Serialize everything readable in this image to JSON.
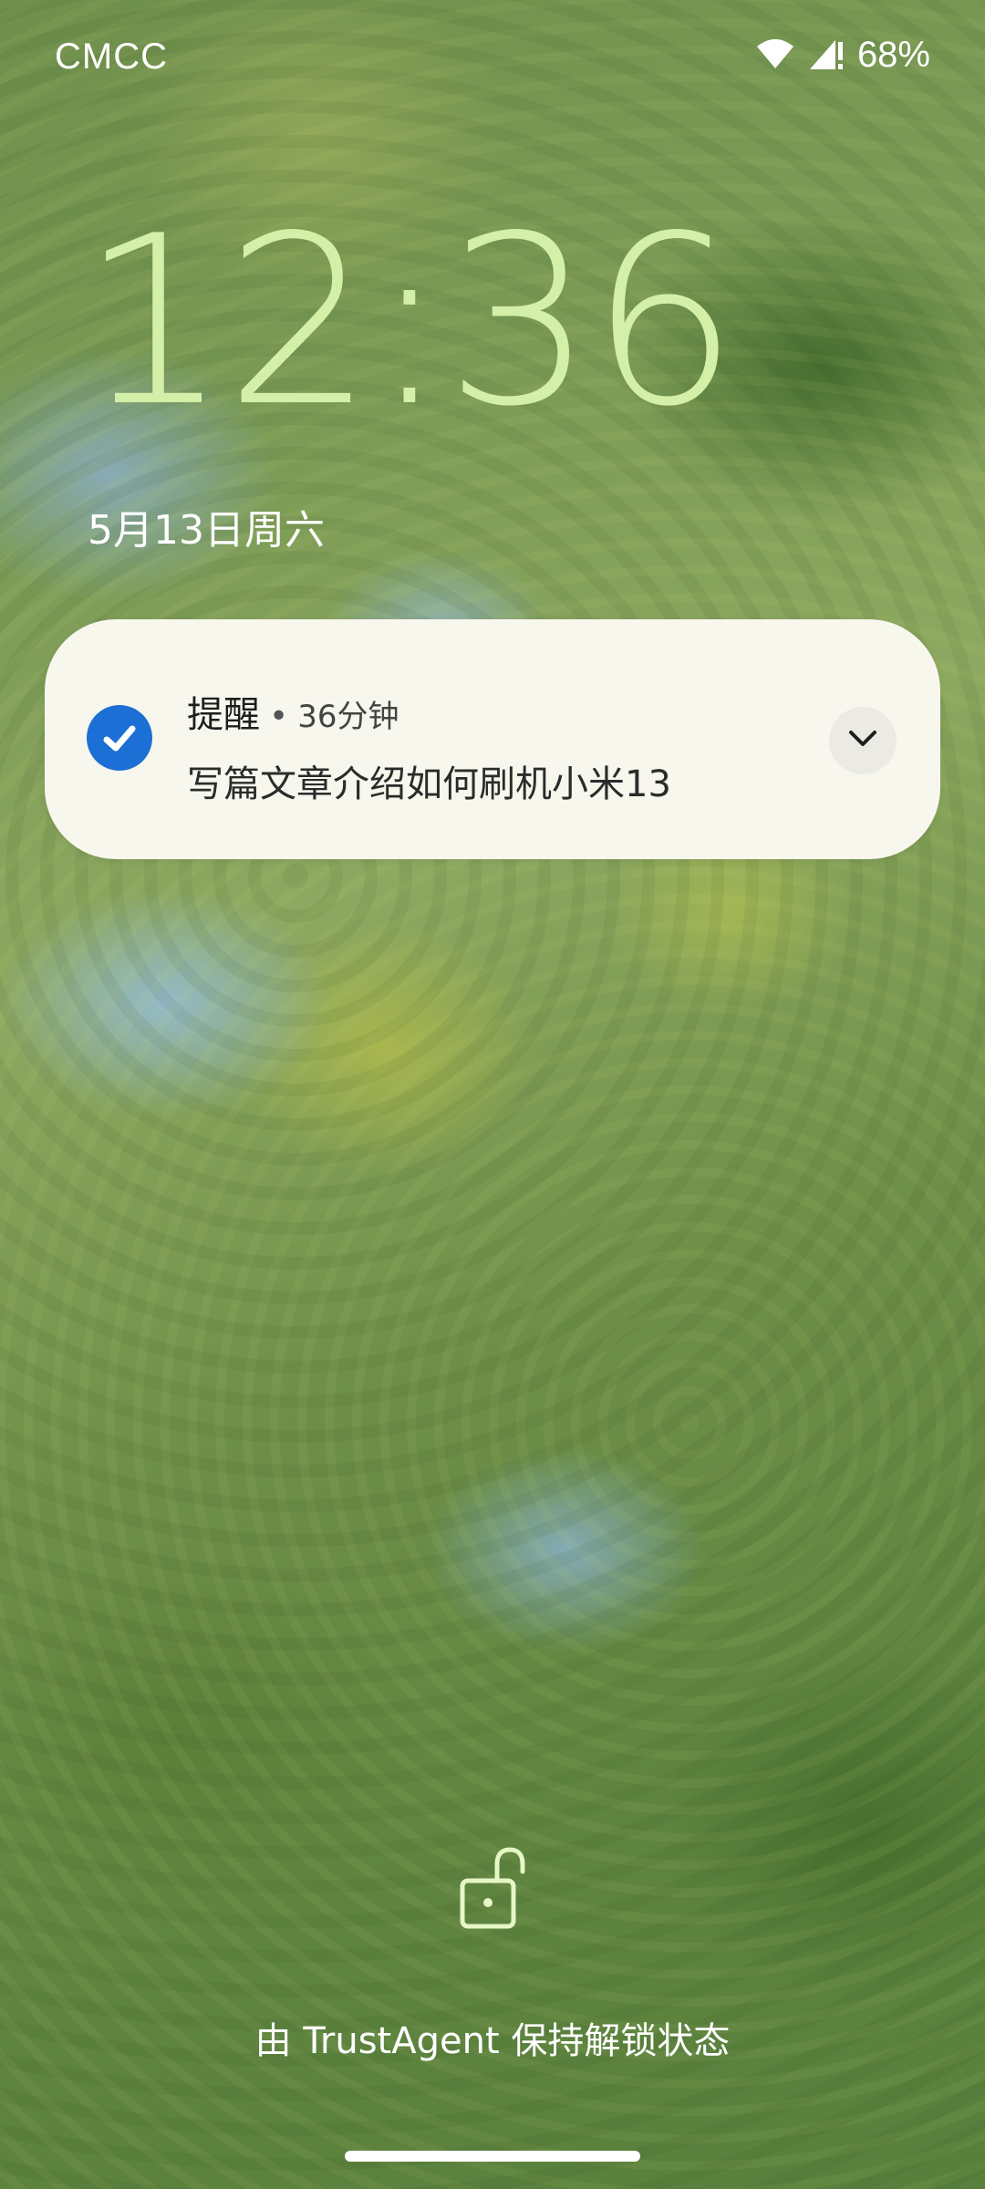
{
  "status_bar": {
    "carrier": "CMCC",
    "battery": "68%",
    "icons": [
      "wifi-icon",
      "signal-icon",
      "battery-icon"
    ]
  },
  "lock_screen": {
    "time": "12:36",
    "date": "5月13日周六",
    "clock_color": "#d4f0a8"
  },
  "notification": {
    "app_name": "提醒",
    "separator": "•",
    "time_ago": "36分钟",
    "text": "写篇文章介绍如何刷机小米13",
    "icon": "check-circle-icon",
    "icon_color": "#1c6fd4",
    "expand_icon": "chevron-down-icon"
  },
  "unlock": {
    "icon": "unlocked-padlock-icon",
    "message": "由 TrustAgent 保持解锁状态"
  }
}
